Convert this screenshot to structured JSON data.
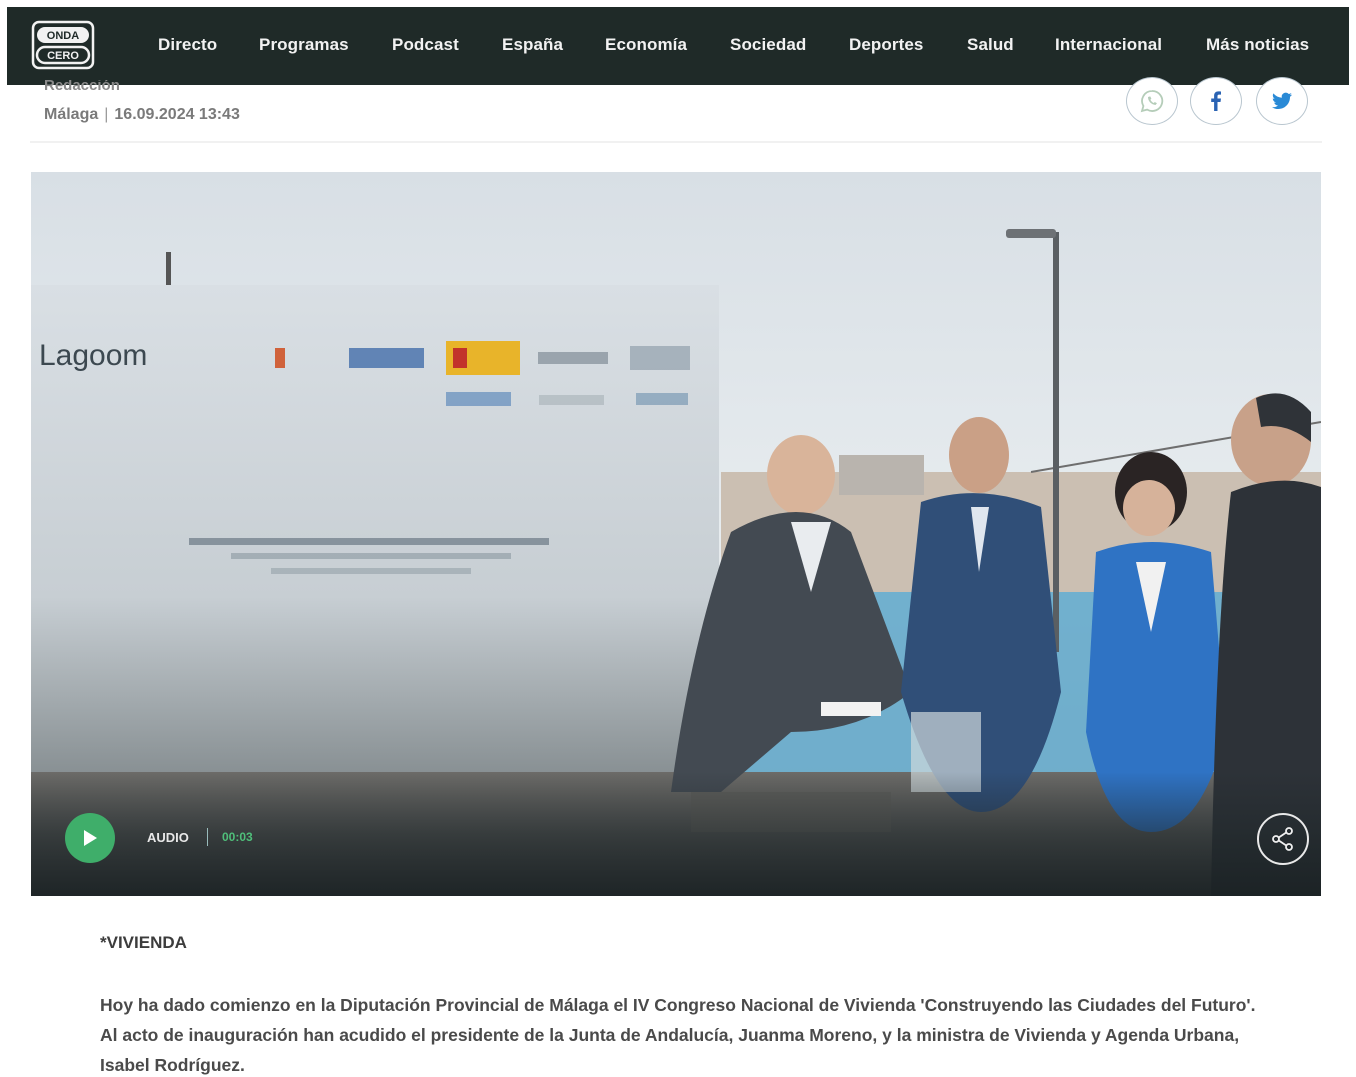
{
  "header": {
    "logo_text_top": "ONDA",
    "logo_text_bottom": "CERO",
    "nav": [
      {
        "label": "Directo"
      },
      {
        "label": "Programas"
      },
      {
        "label": "Podcast"
      },
      {
        "label": "España"
      },
      {
        "label": "Economía"
      },
      {
        "label": "Sociedad"
      },
      {
        "label": "Deportes"
      },
      {
        "label": "Salud"
      },
      {
        "label": "Internacional"
      },
      {
        "label": "Más noticias"
      }
    ]
  },
  "article": {
    "author": "Redacción",
    "location": "Málaga",
    "datetime": "16.09.2024 13:43",
    "share": [
      "whatsapp-icon",
      "facebook-icon",
      "twitter-icon"
    ],
    "hero": {
      "banner_brand": "Lagoom",
      "audio_label": "AUDIO",
      "audio_time": "00:03"
    },
    "kicker": "*VIVIENDA",
    "lead": "Hoy ha dado comienzo en la Diputación Provincial de Málaga el IV Congreso Nacional de Vivienda 'Construyendo las Ciudades del Futuro'. Al acto de inauguración han acudido el presidente de la Junta de Andalucía, Juanma Moreno, y la ministra de Vivienda y Agenda Urbana, Isabel Rodríguez."
  },
  "colors": {
    "header_bg": "#1f2a28",
    "accent_green": "#3fae6a",
    "text": "#4a4a4a"
  }
}
